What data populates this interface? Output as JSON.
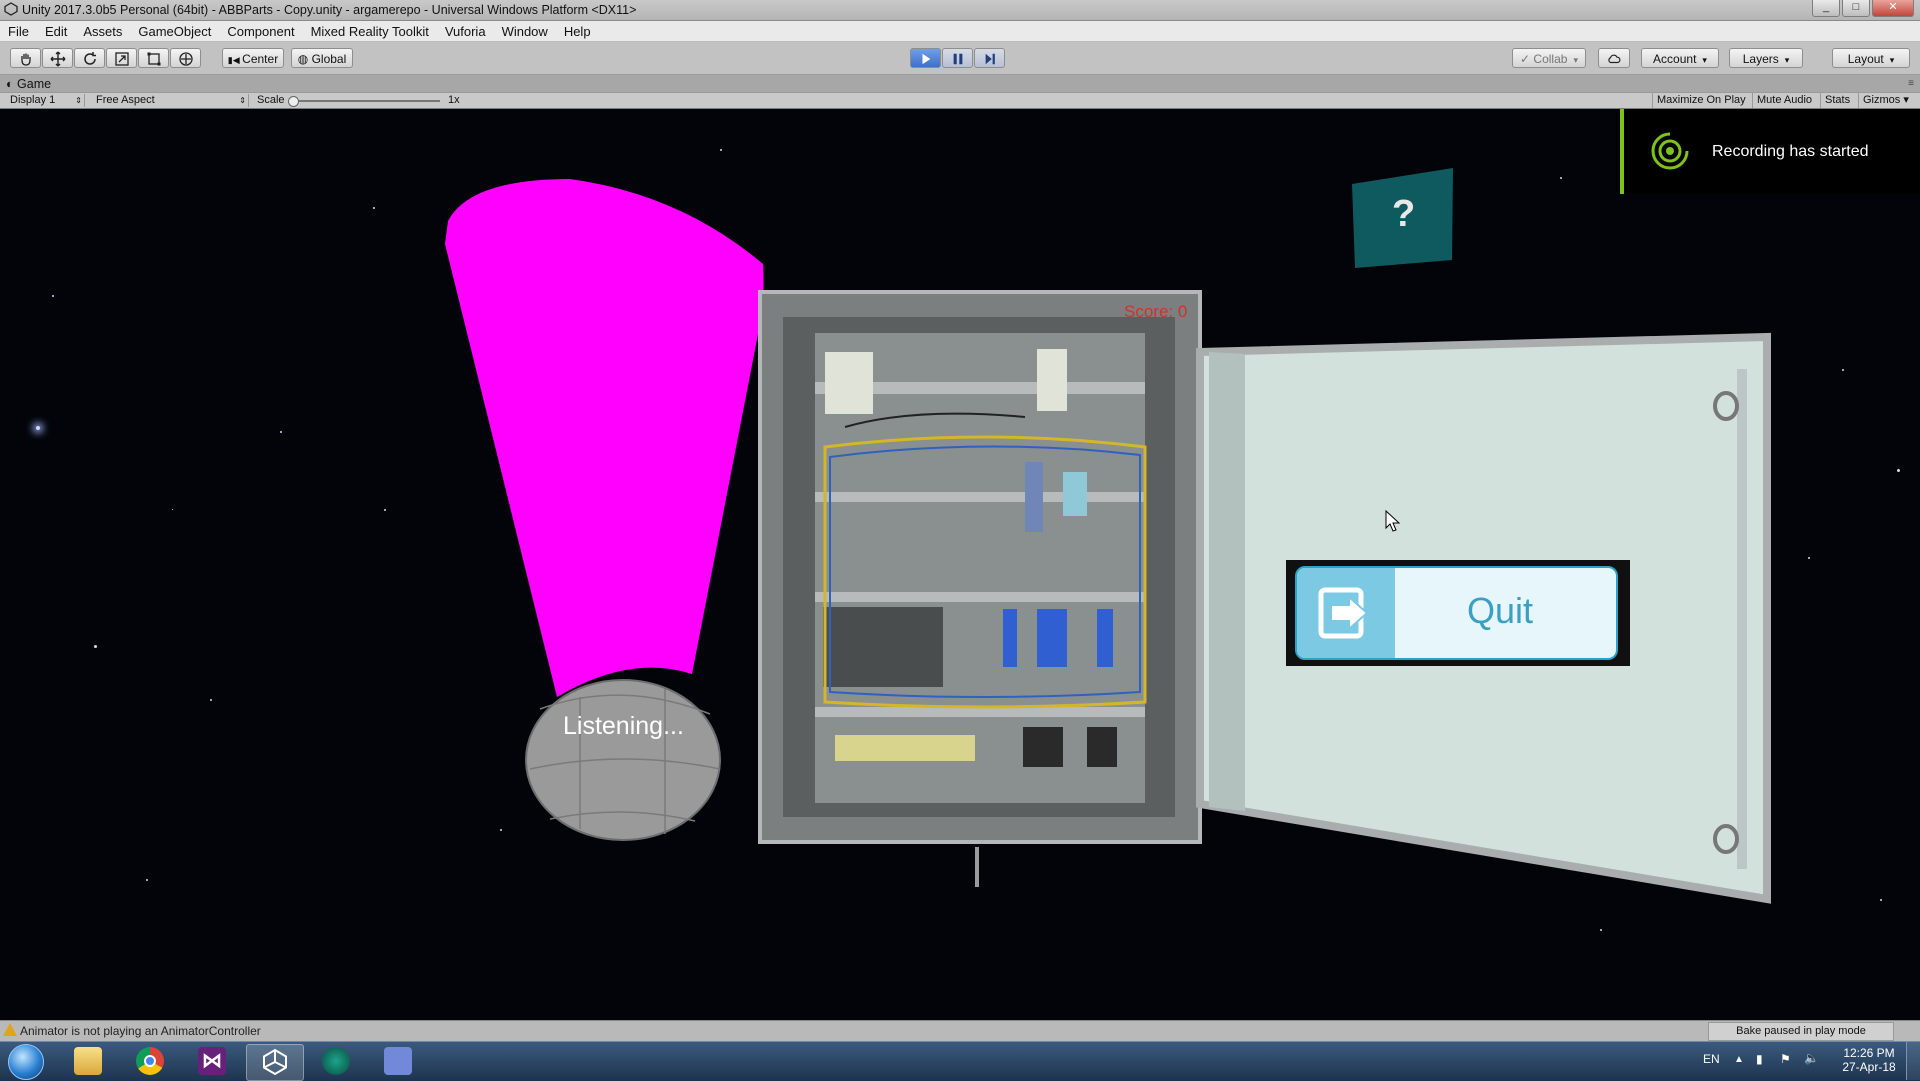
{
  "window": {
    "title": "Unity 2017.3.0b5 Personal (64bit) - ABBParts - Copy.unity - argamerepo - Universal Windows Platform <DX11>",
    "buttons": [
      "_",
      "□",
      "✕"
    ]
  },
  "menu": [
    "File",
    "Edit",
    "Assets",
    "GameObject",
    "Component",
    "Mixed Reality Toolkit",
    "Vuforia",
    "Window",
    "Help"
  ],
  "toolbar": {
    "tools": [
      "hand-icon",
      "move-icon",
      "rotate-icon",
      "scale-icon",
      "rect-icon",
      "transform-icon"
    ],
    "pivot": "Center",
    "space": "Global",
    "playback": {
      "play": "play-icon",
      "pause": "pause-icon",
      "step": "step-icon",
      "playing": true
    },
    "collab": "Collab",
    "account": "Account",
    "layers": "Layers",
    "layout": "Layout"
  },
  "game_view": {
    "tab": "Game",
    "display": "Display 1",
    "aspect": "Free Aspect",
    "scale_label": "Scale",
    "scale_value": "1x",
    "right_buttons": [
      "Maximize On Play",
      "Mute Audio",
      "Stats",
      "Gizmos"
    ]
  },
  "scene": {
    "recording_text": "Recording has started",
    "listening_text": "Listening...",
    "score_text": "Score: 0",
    "help_text": "?",
    "quit_label": "Quit",
    "colors": {
      "beam": "#ff00ff",
      "quit_text": "#3a9fc2",
      "quit_icon_bg": "#7cc9e3",
      "help_panel": "#0e5a5e",
      "recording_accent": "#7fc21a"
    }
  },
  "status": {
    "message": "Animator is not playing an AnimatorController",
    "bake": "Bake paused in play mode"
  },
  "taskbar": {
    "apps": [
      "windows-start-icon",
      "file-explorer-icon",
      "chrome-icon",
      "visual-studio-icon",
      "unity-icon",
      "gitkraken-icon",
      "discord-icon"
    ],
    "language": "EN",
    "time": "12:26 PM",
    "date": "27-Apr-18"
  }
}
